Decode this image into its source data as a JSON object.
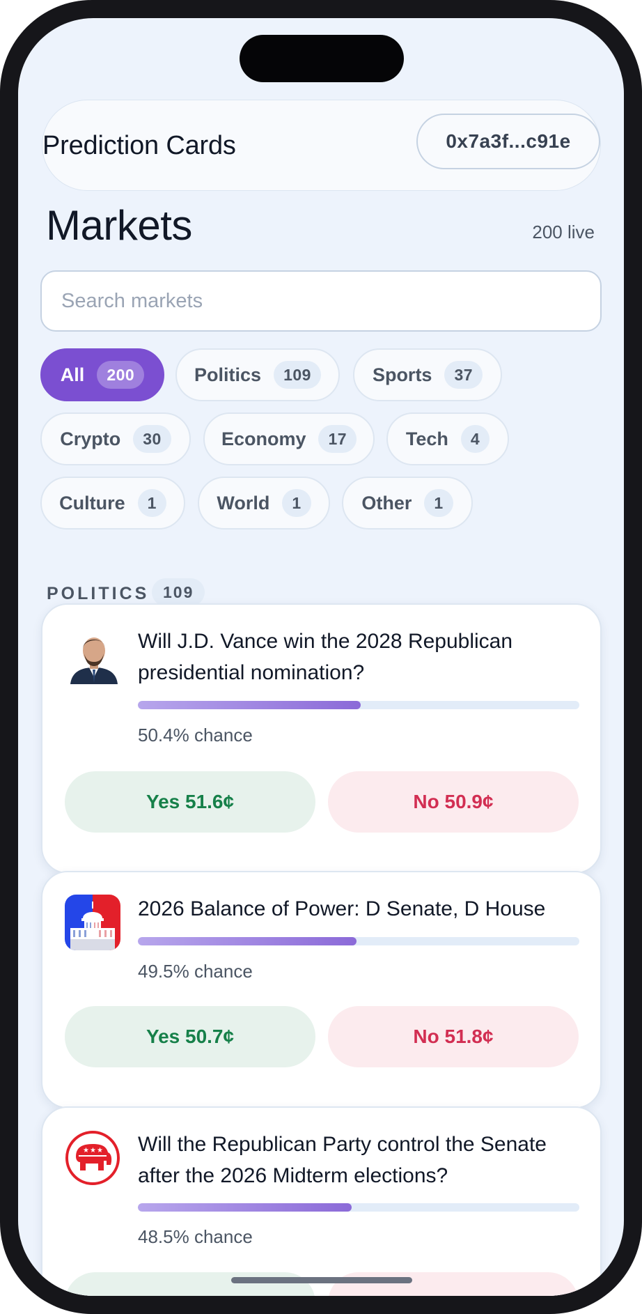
{
  "header": {
    "app_title": "Prediction Cards",
    "wallet_address": "0x7a3f...c91e"
  },
  "page": {
    "title": "Markets",
    "live_count": "200 live"
  },
  "search": {
    "placeholder": "Search markets"
  },
  "filters": [
    {
      "label": "All",
      "count": "200",
      "active": true
    },
    {
      "label": "Politics",
      "count": "109"
    },
    {
      "label": "Sports",
      "count": "37"
    },
    {
      "label": "Crypto",
      "count": "30"
    },
    {
      "label": "Economy",
      "count": "17"
    },
    {
      "label": "Tech",
      "count": "4"
    },
    {
      "label": "Culture",
      "count": "1"
    },
    {
      "label": "World",
      "count": "1"
    },
    {
      "label": "Other",
      "count": "1"
    }
  ],
  "section": {
    "label": "POLITICS",
    "count": "109"
  },
  "markets": [
    {
      "title": "Will J.D. Vance win the 2028 Republican presidential nomination?",
      "chance_value": 50.4,
      "chance_text": "50.4% chance",
      "yes_label": "Yes 51.6¢",
      "no_label": "No 50.9¢",
      "icon": "portrait-avatar"
    },
    {
      "title": "2026 Balance of Power: D Senate, D House",
      "chance_value": 49.5,
      "chance_text": "49.5% chance",
      "yes_label": "Yes 50.7¢",
      "no_label": "No 51.8¢",
      "icon": "capitol-icon"
    },
    {
      "title": "Will the Republican Party control the Senate after the 2026 Midterm elections?",
      "chance_value": 48.5,
      "chance_text": "48.5% chance",
      "yes_label": "",
      "no_label": "",
      "icon": "republican-elephant-icon"
    }
  ],
  "colors": {
    "accent": "#7b4fd1",
    "yes": "#168049",
    "no": "#d22e52",
    "background": "#edf3fc"
  }
}
